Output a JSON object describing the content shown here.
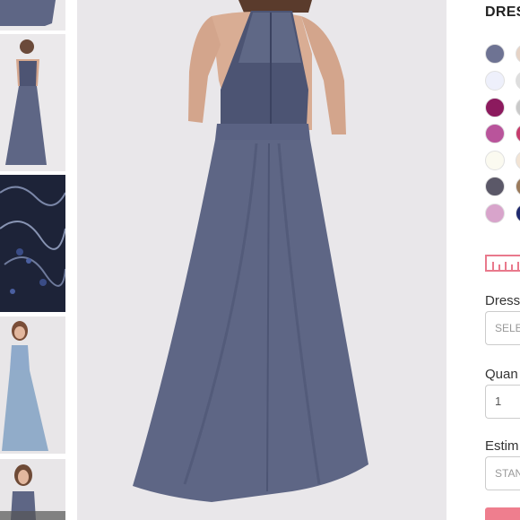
{
  "product": {
    "title": "DRESS"
  },
  "thumbnails": [
    {
      "name": "dress-bottom-view"
    },
    {
      "name": "dress-back-view"
    },
    {
      "name": "lace-detail-view"
    },
    {
      "name": "dress-front-light-blue"
    },
    {
      "name": "dress-front-slate"
    }
  ],
  "colors": {
    "swatches_col1": [
      "#6e7393",
      "#eef0fb",
      "#8c1a5e",
      "#b9549b",
      "#fbfaf0",
      "#5b5868",
      "#d8a4cb"
    ],
    "swatches_col2": [
      "#e6d3c6",
      "#dedede",
      "#c9c9c9",
      "#c63c6c",
      "#f2e4d5",
      "#9a7a5b",
      "#1f2a6e"
    ],
    "accent": "#ef7e8e",
    "dress": "#5e6685"
  },
  "form": {
    "dress_size_label": "Dress",
    "dress_size_placeholder": "SELECT",
    "quantity_label": "Quan",
    "quantity_value": "1",
    "estimated_label": "Estim",
    "estimated_placeholder": "STAN"
  }
}
